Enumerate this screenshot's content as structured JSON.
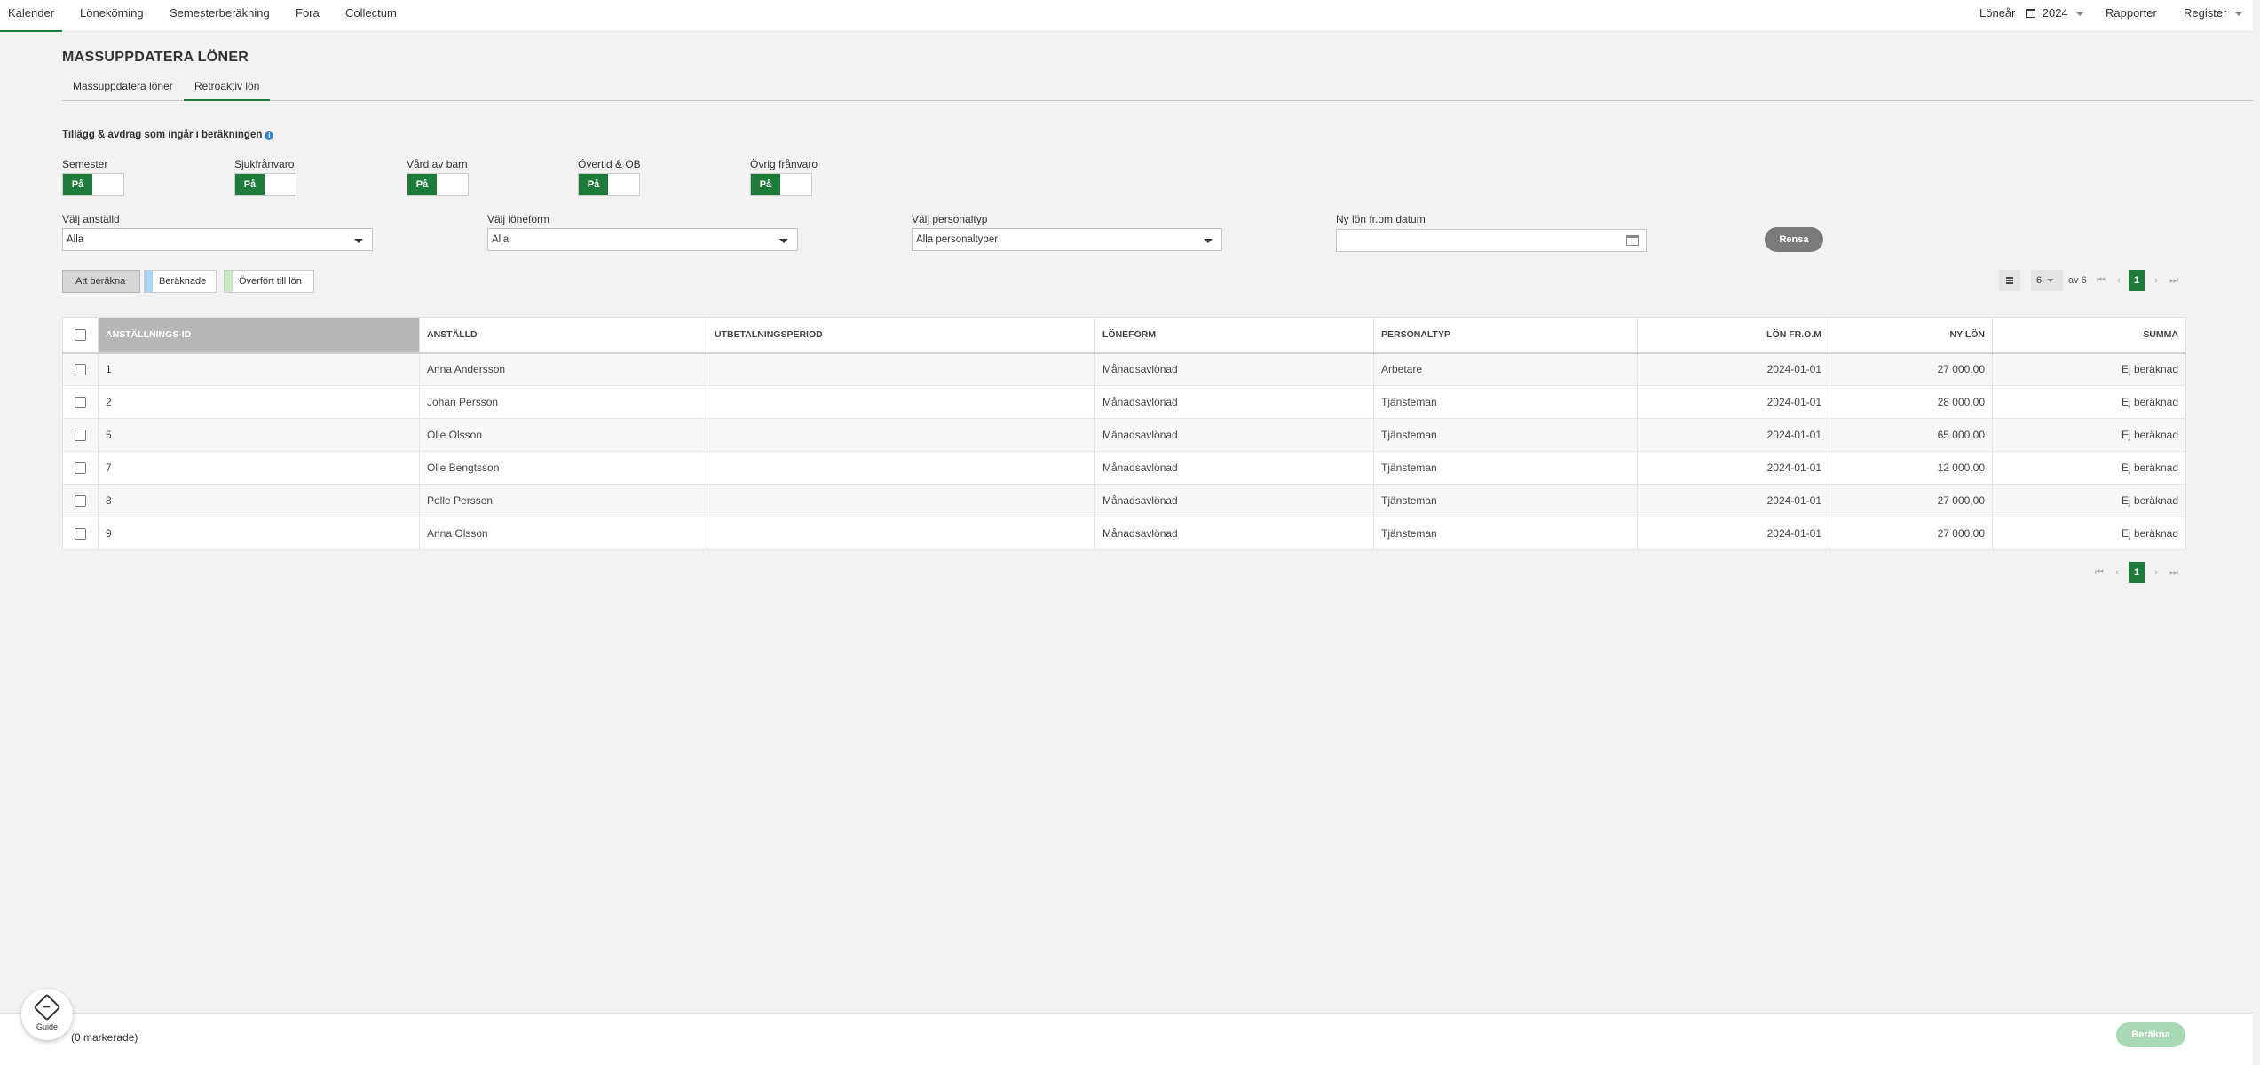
{
  "nav": {
    "items": [
      "Kalender",
      "Lönekörning",
      "Semesterberäkning",
      "Fora",
      "Collectum"
    ],
    "active_index": 0,
    "right": {
      "year_label": "Löneår",
      "year_value": "2024",
      "reports": "Rapporter",
      "register": "Register"
    }
  },
  "page": {
    "title": "MASSUPPDATERA LÖNER",
    "tabs": [
      "Massuppdatera löner",
      "Retroaktiv lön"
    ],
    "active_tab": 1
  },
  "settings": {
    "label": "Tillägg & avdrag som ingår i beräkningen",
    "info_icon": "i",
    "toggles": [
      {
        "label": "Semester",
        "state": "På"
      },
      {
        "label": "Sjukfrånvaro",
        "state": "På"
      },
      {
        "label": "Vård av barn",
        "state": "På"
      },
      {
        "label": "Övertid & OB",
        "state": "På"
      },
      {
        "label": "Övrig frånvaro",
        "state": "På"
      }
    ]
  },
  "filters": {
    "employee": {
      "label": "Välj anställd",
      "value": "Alla"
    },
    "salary_form": {
      "label": "Välj löneform",
      "value": "Alla"
    },
    "staff_type": {
      "label": "Välj personaltyp",
      "value": "Alla personaltyper"
    },
    "date": {
      "label": "Ny lön fr.om datum",
      "value": ""
    },
    "clear_label": "Rensa"
  },
  "status_legend": [
    {
      "label": "Att beräkna",
      "color": ""
    },
    {
      "label": "Beräknade",
      "color": "#a9d6f5"
    },
    {
      "label": "Överfört till lön",
      "color": "#c9ecc0"
    }
  ],
  "pager": {
    "page_size": "6",
    "of_text": "av 6",
    "current_page": "1"
  },
  "table": {
    "columns": [
      "ANSTÄLLNINGS-ID",
      "ANSTÄLLD",
      "UTBETALNINGSPERIOD",
      "LÖNEFORM",
      "PERSONALTYP",
      "LÖN FR.O.M",
      "NY LÖN",
      "SUMMA"
    ],
    "rows": [
      [
        "1",
        "Anna Andersson",
        "",
        "Månadsavlönad",
        "Arbetare",
        "2024-01-01",
        "27 000,00",
        "Ej beräknad"
      ],
      [
        "2",
        "Johan Persson",
        "",
        "Månadsavlönad",
        "Tjänsteman",
        "2024-01-01",
        "28 000,00",
        "Ej beräknad"
      ],
      [
        "5",
        "Olle Olsson",
        "",
        "Månadsavlönad",
        "Tjänsteman",
        "2024-01-01",
        "65 000,00",
        "Ej beräknad"
      ],
      [
        "7",
        "Olle Bengtsson",
        "",
        "Månadsavlönad",
        "Tjänsteman",
        "2024-01-01",
        "12 000,00",
        "Ej beräknad"
      ],
      [
        "8",
        "Pelle Persson",
        "",
        "Månadsavlönad",
        "Tjänsteman",
        "2024-01-01",
        "27 000,00",
        "Ej beräknad"
      ],
      [
        "9",
        "Anna Olsson",
        "",
        "Månadsavlönad",
        "Tjänsteman",
        "2024-01-01",
        "27 000,00",
        "Ej beräknad"
      ]
    ]
  },
  "footer": {
    "marked": "(0 markerade)",
    "calculate": "Beräkna"
  },
  "guide": {
    "label": "Guide"
  },
  "colors": {
    "accent": "#1e7c3a",
    "sorted_header": "#b6b6b6",
    "disabled_button": "#a8d8b4",
    "clear_button": "#7a7a7a"
  }
}
